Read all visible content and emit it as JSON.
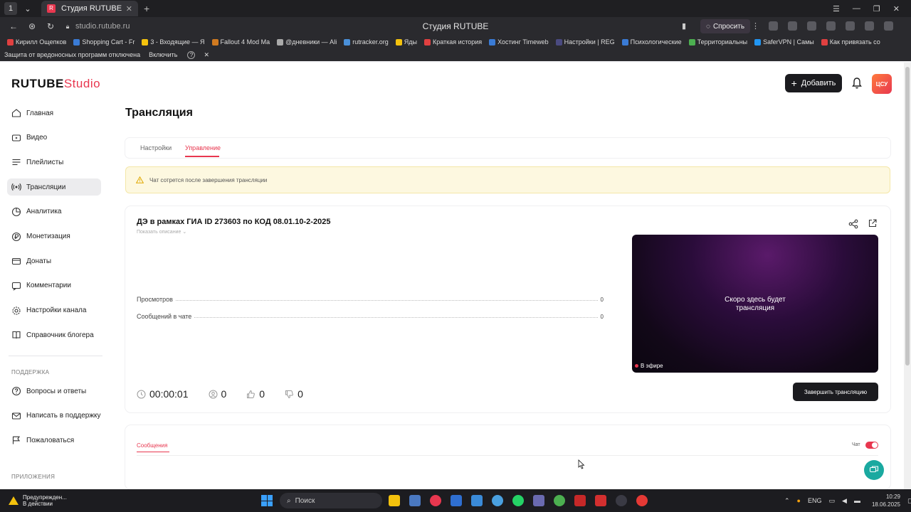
{
  "browser": {
    "tab_title": "Студия RUTUBE",
    "tab_favicon": "R",
    "window_title": "Студия RUTUBE",
    "url": "studio.rutube.ru",
    "ask_label": "Спросить",
    "bookmarks": [
      {
        "label": "Кирилл Ощепков",
        "color": "#e04040"
      },
      {
        "label": "Shopping Cart - Fr",
        "color": "#3a7bd5"
      },
      {
        "label": "3 - Входящие — Я",
        "color": "#f4c20d"
      },
      {
        "label": "Fallout 4 Mod Ma",
        "color": "#d07a20"
      },
      {
        "label": "@дневники — Ali",
        "color": "#aaaaaa"
      },
      {
        "label": "rutracker.org",
        "color": "#4a90d9"
      },
      {
        "label": "Яды",
        "color": "#f4c20d"
      },
      {
        "label": "Краткая история",
        "color": "#e04040"
      },
      {
        "label": "Хостинг Timeweb",
        "color": "#3a7bd5"
      },
      {
        "label": "Настройки | REG",
        "color": "#4a4a80"
      },
      {
        "label": "Психологические",
        "color": "#3a7bd5"
      },
      {
        "label": "Территориальны",
        "color": "#4caf50"
      },
      {
        "label": "SaferVPN | Самы",
        "color": "#2196f3"
      },
      {
        "label": "Как привязать со",
        "color": "#e04040"
      }
    ],
    "infobar": {
      "text": "Защита от вредоносных программ отключена",
      "enable": "Включить"
    }
  },
  "header": {
    "logo_main": "RUTUBE",
    "logo_studio": "Studio",
    "add_label": "Добавить",
    "avatar_text": "ЦСУ"
  },
  "sidebar": {
    "items": [
      {
        "label": "Главная",
        "icon": "home-icon"
      },
      {
        "label": "Видео",
        "icon": "video-icon"
      },
      {
        "label": "Плейлисты",
        "icon": "playlist-icon"
      },
      {
        "label": "Трансляции",
        "icon": "broadcast-icon",
        "active": true
      },
      {
        "label": "Аналитика",
        "icon": "analytics-icon"
      },
      {
        "label": "Монетизация",
        "icon": "ruble-icon"
      },
      {
        "label": "Донаты",
        "icon": "donate-icon"
      },
      {
        "label": "Комментарии",
        "icon": "comment-icon"
      },
      {
        "label": "Настройки канала",
        "icon": "gear-icon"
      },
      {
        "label": "Справочник блогера",
        "icon": "book-icon"
      }
    ],
    "support_title": "ПОДДЕРЖКА",
    "support_items": [
      {
        "label": "Вопросы и ответы",
        "icon": "question-icon"
      },
      {
        "label": "Написать в поддержку",
        "icon": "mail-icon"
      },
      {
        "label": "Пожаловаться",
        "icon": "report-icon"
      }
    ],
    "apps_title": "ПРИЛОЖЕНИЯ"
  },
  "main": {
    "title": "Трансляция",
    "tabs": [
      {
        "label": "Настройки",
        "active": false
      },
      {
        "label": "Управление",
        "active": true
      }
    ],
    "warning": "Чат сотрется после завершения трансляции",
    "stream": {
      "title": "ДЭ в рамках ГИА ID 273603 по КОД 08.01.10-2-2025",
      "show_description": "Показать описание",
      "stats": [
        {
          "label": "Просмотров",
          "value": "0"
        },
        {
          "label": "Сообщений в чате",
          "value": "0"
        }
      ],
      "preview_line1": "Скоро здесь будет",
      "preview_line2": "трансляция",
      "live_label": "В эфире",
      "duration": "00:00:01",
      "viewers": "0",
      "likes": "0",
      "dislikes": "0",
      "end_label": "Завершить трансляцию"
    },
    "chat": {
      "tab_label": "Сообщения",
      "toggle_label": "Чат",
      "toggle_on": true
    }
  },
  "taskbar": {
    "notice_line1": "Предупрежден...",
    "notice_line2": "В действии",
    "search_label": "Поиск",
    "lang": "ENG",
    "time": "10:29",
    "date": "18.06.2025"
  },
  "colors": {
    "accent": "#e8374f",
    "dark_button": "#1b1b1f",
    "warning_bg": "#fdf8e0",
    "help_fab": "#1aa9a0"
  }
}
